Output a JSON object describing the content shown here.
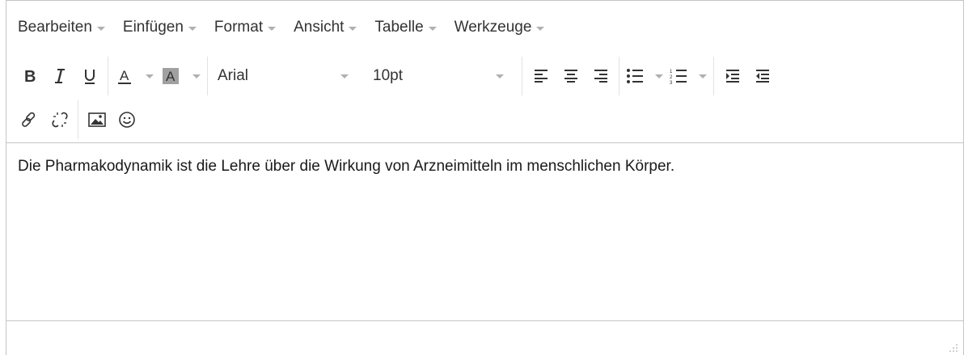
{
  "menubar": {
    "items": [
      {
        "label": "Bearbeiten"
      },
      {
        "label": "Einfügen"
      },
      {
        "label": "Format"
      },
      {
        "label": "Ansicht"
      },
      {
        "label": "Tabelle"
      },
      {
        "label": "Werkzeuge"
      }
    ]
  },
  "toolbar": {
    "font_family": "Arial",
    "font_size": "10pt",
    "text_color_glyph": "A",
    "bg_color_glyph": "A"
  },
  "content": {
    "text": "Die Pharmakodynamik ist die Lehre über die Wirkung von Arzneimitteln im menschlichen Körper."
  },
  "colors": {
    "border": "#c5c5c5",
    "text": "#333333",
    "caret": "#b0b0b0",
    "highlight_swatch": "#a0a0a0"
  }
}
